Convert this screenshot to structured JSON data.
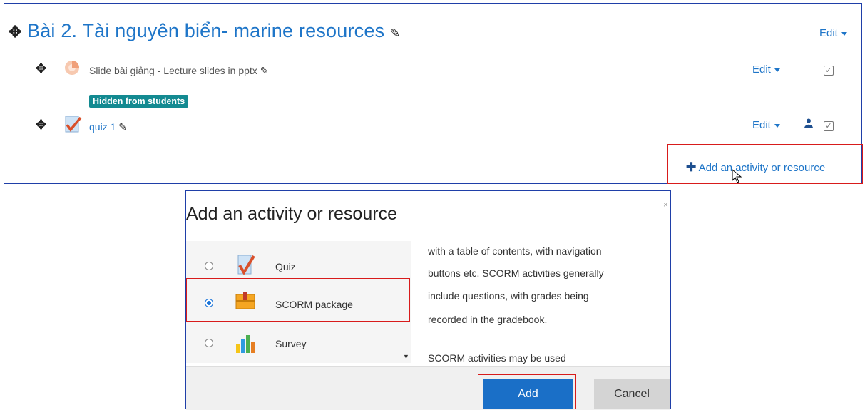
{
  "section": {
    "title": "Bài 2. Tài nguyên biển- marine resources",
    "edit_label": "Edit",
    "activities": [
      {
        "name": "Slide bài giảng - Lecture slides in pptx",
        "edit_label": "Edit",
        "badge": "Hidden from students"
      },
      {
        "name": "quiz 1",
        "edit_label": "Edit"
      }
    ],
    "add_activity_label": "Add an activity or resource"
  },
  "modal": {
    "title": "Add an activity or resource",
    "options": [
      {
        "label": "Quiz",
        "selected": false
      },
      {
        "label": "SCORM package",
        "selected": true
      },
      {
        "label": "Survey",
        "selected": false
      }
    ],
    "description_lines": [
      "with a table of contents, with navigation",
      "buttons etc. SCORM activities generally",
      "include questions, with grades being",
      "recorded in the gradebook.",
      "",
      "SCORM activities may be used"
    ],
    "add_label": "Add",
    "cancel_label": "Cancel"
  },
  "colors": {
    "link": "#1e75c8",
    "badge": "#138a91",
    "highlight": "#d81b1b",
    "frame": "#1f3fa8",
    "primary": "#1a6fc7"
  }
}
